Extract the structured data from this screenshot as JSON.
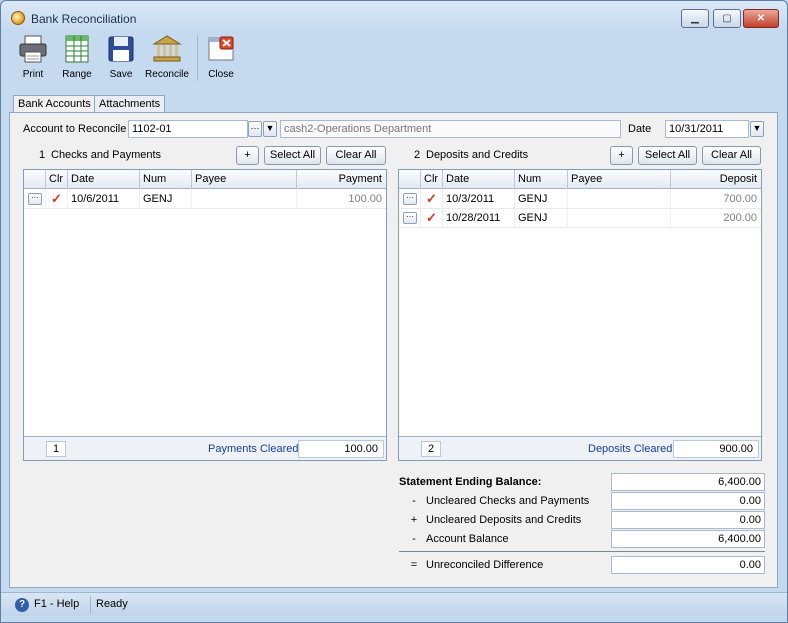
{
  "window": {
    "title": "Bank Reconciliation"
  },
  "toolbar": {
    "print": "Print",
    "range": "Range",
    "save": "Save",
    "reconcile": "Reconcile",
    "close": "Close"
  },
  "tabs": [
    "Bank Accounts",
    "Attachments"
  ],
  "account": {
    "label": "Account to Reconcile",
    "value": "1102-01",
    "description": "cash2-Operations Department",
    "date_label": "Date",
    "date": "10/31/2011"
  },
  "checks": {
    "number": "1",
    "title": "Checks and Payments",
    "add": "+",
    "select_all": "Select All",
    "clear_all": "Clear All",
    "columns": [
      "Clr",
      "Date",
      "Num",
      "Payee",
      "Payment"
    ],
    "rows": [
      {
        "cleared": "✓",
        "date": "10/6/2011",
        "num": "GENJ",
        "payee": "",
        "amount": "100.00"
      }
    ],
    "count": "1",
    "cleared_label": "Payments Cleared",
    "cleared_total": "100.00"
  },
  "deposits": {
    "number": "2",
    "title": "Deposits and Credits",
    "add": "+",
    "select_all": "Select All",
    "clear_all": "Clear All",
    "columns": [
      "Clr",
      "Date",
      "Num",
      "Payee",
      "Deposit"
    ],
    "rows": [
      {
        "cleared": "✓",
        "date": "10/3/2011",
        "num": "GENJ",
        "payee": "",
        "amount": "700.00"
      },
      {
        "cleared": "✓",
        "date": "10/28/2011",
        "num": "GENJ",
        "payee": "",
        "amount": "200.00"
      }
    ],
    "count": "2",
    "cleared_label": "Deposits Cleared",
    "cleared_total": "900.00"
  },
  "summary": {
    "statement_label": "Statement Ending Balance:",
    "statement_value": "6,400.00",
    "uncleared_checks_sign": "-",
    "uncleared_checks_label": "Uncleared Checks and Payments",
    "uncleared_checks_value": "0.00",
    "uncleared_deposits_sign": "+",
    "uncleared_deposits_label": "Uncleared Deposits and Credits",
    "uncleared_deposits_value": "0.00",
    "account_balance_sign": "-",
    "account_balance_label": "Account Balance",
    "account_balance_value": "6,400.00",
    "difference_sign": "=",
    "difference_label": "Unreconciled Difference",
    "difference_value": "0.00"
  },
  "status": {
    "help": "F1 - Help",
    "state": "Ready"
  },
  "colors": {
    "accent": "#1a3f8f",
    "check_mark": "#d23a1a"
  }
}
